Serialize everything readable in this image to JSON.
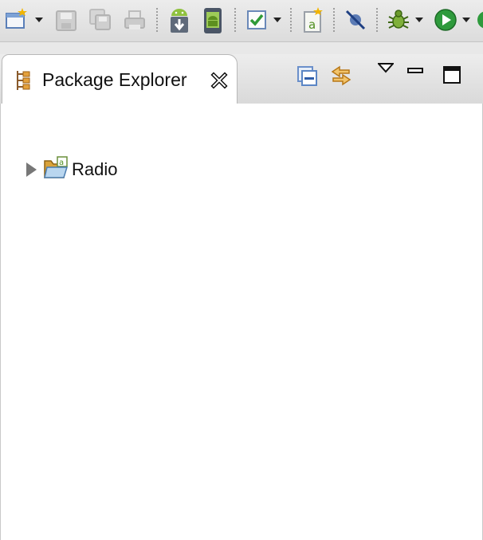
{
  "toolbar": {
    "buttons": [
      {
        "icon": "new-wizard-icon",
        "enabled": true,
        "has_dropdown": true
      },
      {
        "icon": "save-icon",
        "enabled": false
      },
      {
        "icon": "save-all-icon",
        "enabled": false
      },
      {
        "icon": "print-icon",
        "enabled": false
      },
      {
        "icon": "android-sdk-manager-icon",
        "enabled": true
      },
      {
        "icon": "android-avd-manager-icon",
        "enabled": true
      },
      {
        "icon": "lint-check-icon",
        "enabled": true,
        "has_dropdown": true
      },
      {
        "icon": "new-android-project-icon",
        "enabled": true
      },
      {
        "icon": "skip-breakpoints-icon",
        "enabled": true
      },
      {
        "icon": "debug-icon",
        "enabled": true,
        "has_dropdown": true
      },
      {
        "icon": "run-icon",
        "enabled": true,
        "has_dropdown": true
      }
    ]
  },
  "package_explorer": {
    "tab_title": "Package Explorer",
    "tab_icon": "package-explorer-icon",
    "close_icon": "close-tab-icon",
    "view_actions": [
      "collapse-all-icon",
      "link-with-editor-icon",
      "view-menu-icon",
      "minimize-icon",
      "maximize-icon"
    ],
    "tree": [
      {
        "label": "Radio",
        "icon": "android-project-folder-icon",
        "expanded": false
      }
    ]
  },
  "colors": {
    "android_green": "#8fc13e",
    "run_green": "#2e9a3c",
    "link_orange": "#e8a33a",
    "collapse_blue": "#5b86c5"
  }
}
